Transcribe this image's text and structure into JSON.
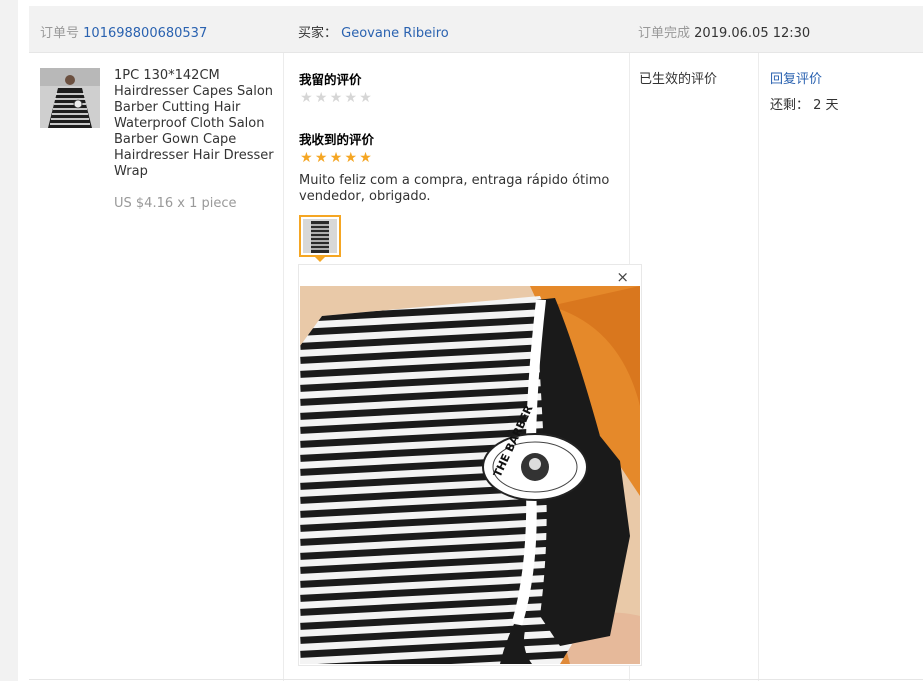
{
  "order": {
    "number_label": "订单号",
    "number_value": "101698800680537",
    "buyer_label": "买家：",
    "buyer_name": "Geovane Ribeiro",
    "status_label": "订单完成",
    "completed_time": "2019.06.05 12:30"
  },
  "product": {
    "title": "1PC 130*142CM Hairdresser Capes Salon Barber Cutting Hair Waterproof Cloth Salon Barber Gown Cape Hairdresser Hair Dresser Wrap",
    "price": "US $4.16 x 1 piece"
  },
  "my_review": {
    "title": "我留的评价",
    "rating": 0,
    "max_rating": 5
  },
  "received_review": {
    "title": "我收到的评价",
    "rating": 5,
    "max_rating": 5,
    "text": "Muito feliz com a compra, entraga rápido ótimo vendedor, obrigado.",
    "preview_close": "×",
    "patch_text": "THE BARBER"
  },
  "status": {
    "effective": "已生效的评价",
    "reply_link": "回复评价",
    "remaining_label": "还剩：",
    "remaining_value": "2 天"
  },
  "colors": {
    "link": "#2a62b0",
    "star_full": "#f5a623",
    "star_empty": "#d6d6d6",
    "header_bg": "#f2f2f2"
  }
}
